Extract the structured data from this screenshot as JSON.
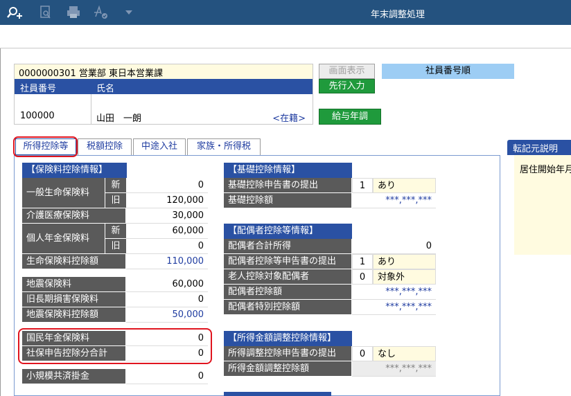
{
  "window": {
    "title": "年末調整処理"
  },
  "toolbar": {
    "icons": [
      "search-plus-icon",
      "document-search-icon",
      "printer-icon",
      "sign-check-icon",
      "dropdown-triangle-icon"
    ]
  },
  "employee": {
    "header": "0000000301 営業部 東日本営業課",
    "col_number": "社員番号",
    "col_name": "氏名",
    "number": "100000",
    "name": "山田　一朗",
    "status": "<在籍>"
  },
  "buttons": {
    "screen_display": "画面表示",
    "order": "社員番号順",
    "prev_input": "先行入力",
    "salary_adjust": "給与年調"
  },
  "tabs": [
    "所得控除等",
    "税額控除",
    "中途入社",
    "家族・所得税"
  ],
  "side_panel": {
    "title": "転記元説明",
    "text": "居住開始年月"
  },
  "insurance": {
    "title": "【保険料控除情報】",
    "general_life": "一般生命保険料",
    "new": "新",
    "old": "旧",
    "general_life_new": "0",
    "general_life_old": "120,000",
    "care_medical": "介護医療保険料",
    "care_medical_value": "30,000",
    "pension": "個人年金保険料",
    "pension_new": "60,000",
    "pension_old": "0",
    "life_deduction": "生命保険料控除額",
    "life_deduction_value": "110,000"
  },
  "earthquake": {
    "eq": "地震保険料",
    "eq_value": "60,000",
    "old_long": "旧長期損害保険料",
    "old_long_value": "0",
    "eq_deduction": "地震保険料控除額",
    "eq_deduction_value": "50,000"
  },
  "national": {
    "pension": "国民年金保険料",
    "pension_value": "0",
    "social_total": "社保申告控除分合計",
    "social_total_value": "0"
  },
  "small_mutual": {
    "label": "小規模共済掛金",
    "value": "0"
  },
  "basic": {
    "title": "【基礎控除情報】",
    "submit": "基礎控除申告書の提出",
    "submit_code": "1",
    "submit_text": "あり",
    "amount": "基礎控除額",
    "amount_value": "***,***,***"
  },
  "spouse": {
    "title": "【配偶者控除等情報】",
    "income": "配偶者合計所得",
    "income_value": "0",
    "submit": "配偶者控除等申告書の提出",
    "submit_code": "1",
    "submit_text": "あり",
    "elderly": "老人控除対象配偶者",
    "elderly_code": "0",
    "elderly_text": "対象外",
    "deduction": "配偶者控除額",
    "deduction_value": "***,***,***",
    "special": "配偶者特別控除額",
    "special_value": "***,***,***"
  },
  "income_adjust": {
    "title": "【所得金額調整控除情報】",
    "submit": "所得調整控除申告書の提出",
    "submit_code": "0",
    "submit_text": "なし",
    "amount": "所得金額調整控除額",
    "amount_value": "***,***,***"
  },
  "colors": {
    "titlebar": "#24527f",
    "header_blue": "#2a51a3",
    "label_gray": "#5a5a5a",
    "highlight": "#e0141e",
    "green": "#1f9a3c"
  }
}
